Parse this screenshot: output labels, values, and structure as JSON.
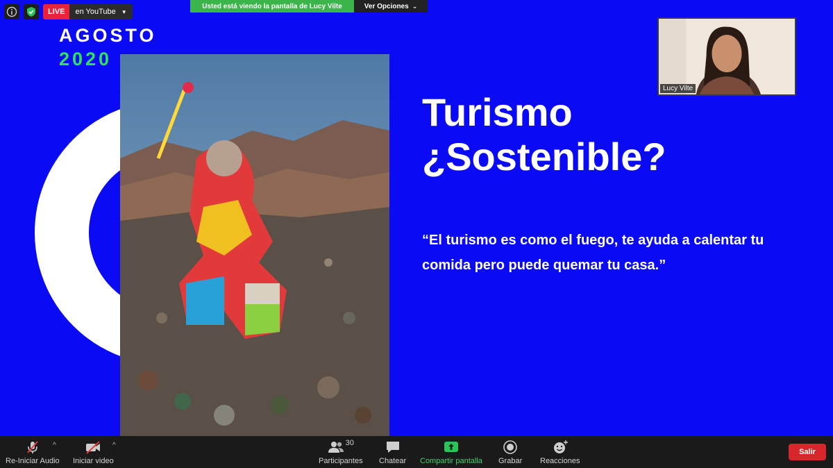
{
  "slide": {
    "brand_month": "AGOSTO",
    "brand_year": "2020",
    "title_line1": "Turismo",
    "title_line2": "¿Sostenible?",
    "quote_line1": "“El turismo es como el fuego, te ayuda a calentar tu",
    "quote_line2": "comida pero puede quemar tu casa.”"
  },
  "topbar": {
    "live_label": "LIVE",
    "live_destination": "en YouTube",
    "share_banner": "Usted está viendo la pantalla de Lucy Vilte",
    "view_options": "Ver Opciones"
  },
  "video": {
    "participant_name": "Lucy Vilte"
  },
  "bottombar": {
    "audio_label": "Re-Iniciar Audio",
    "video_label": "Iniciar video",
    "participants_label": "Participantes",
    "participants_count": "30",
    "chat_label": "Chatear",
    "share_label": "Compartir pantalla",
    "record_label": "Grabar",
    "reactions_label": "Reacciones",
    "leave_label": "Salir"
  },
  "colors": {
    "slide_bg": "#0a0af5",
    "brand_green": "#2ee35a",
    "share_green": "#3bb54a",
    "live_red": "#e8243a",
    "leave_red": "#d8262a"
  }
}
